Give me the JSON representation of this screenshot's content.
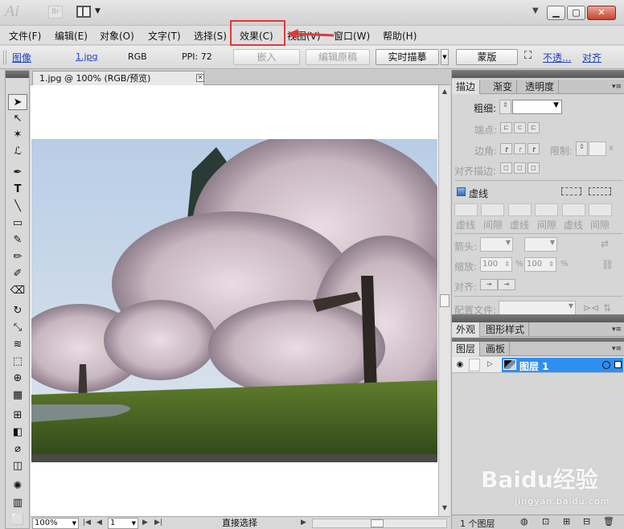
{
  "app": {
    "logo_text": "Ai",
    "bridge_label": "Br"
  },
  "menu": [
    {
      "label": "文件(F)"
    },
    {
      "label": "编辑(E)"
    },
    {
      "label": "对象(O)"
    },
    {
      "label": "文字(T)"
    },
    {
      "label": "选择(S)"
    },
    {
      "label": "效果(C)"
    },
    {
      "label": "视图(V)"
    },
    {
      "label": "窗口(W)"
    },
    {
      "label": "帮助(H)"
    }
  ],
  "highlight": {
    "target": "效果(C)",
    "color": "#e03a3a"
  },
  "controlbar": {
    "object_type": "图像",
    "filename": "1.jpg",
    "color_mode": "RGB",
    "ppi": "PPI: 72",
    "embed_button": "嵌入",
    "edit_original_button": "编辑原稿",
    "live_trace_button": "实时描摹",
    "mask_button": "蒙版",
    "opacity_link": "不透...",
    "align_label": "对齐"
  },
  "document": {
    "tab_title": "1.jpg @ 100% (RGB/预览)",
    "zoom": "100%",
    "page": "1",
    "current_tool": "直接选择"
  },
  "stroke_panel": {
    "tabs": [
      "描边",
      "渐变",
      "透明度"
    ],
    "weight_label": "粗细:",
    "cap_label": "端点:",
    "corner_label": "边角:",
    "limit_label": "限制:",
    "limit_suffix": "x",
    "align_label": "对齐描边:",
    "dashed_label": "虚线",
    "dash_labels": [
      "虚线",
      "间隙",
      "虚线",
      "间隙",
      "虚线",
      "间隙"
    ],
    "arrow_label": "箭头:",
    "scale_label": "缩放:",
    "scale_start": "100",
    "scale_end": "100",
    "percent": "%",
    "arrow_align_label": "对齐:",
    "profile_label": "配置文件:"
  },
  "appearance_panel": {
    "tabs": [
      "外观",
      "图形样式"
    ]
  },
  "layers_panel": {
    "tabs": [
      "图层",
      "画板"
    ],
    "layer_name": "图层 1",
    "footer_count": "1 个图层",
    "selection_color": "#2f8ff0"
  },
  "watermark": {
    "text": "Baidu经验",
    "sub": "jingyan.baidu.com"
  },
  "icons": {
    "eye": "eye-icon",
    "minimize": "minimize-icon",
    "maximize": "maximize-icon",
    "close": "close-icon"
  }
}
